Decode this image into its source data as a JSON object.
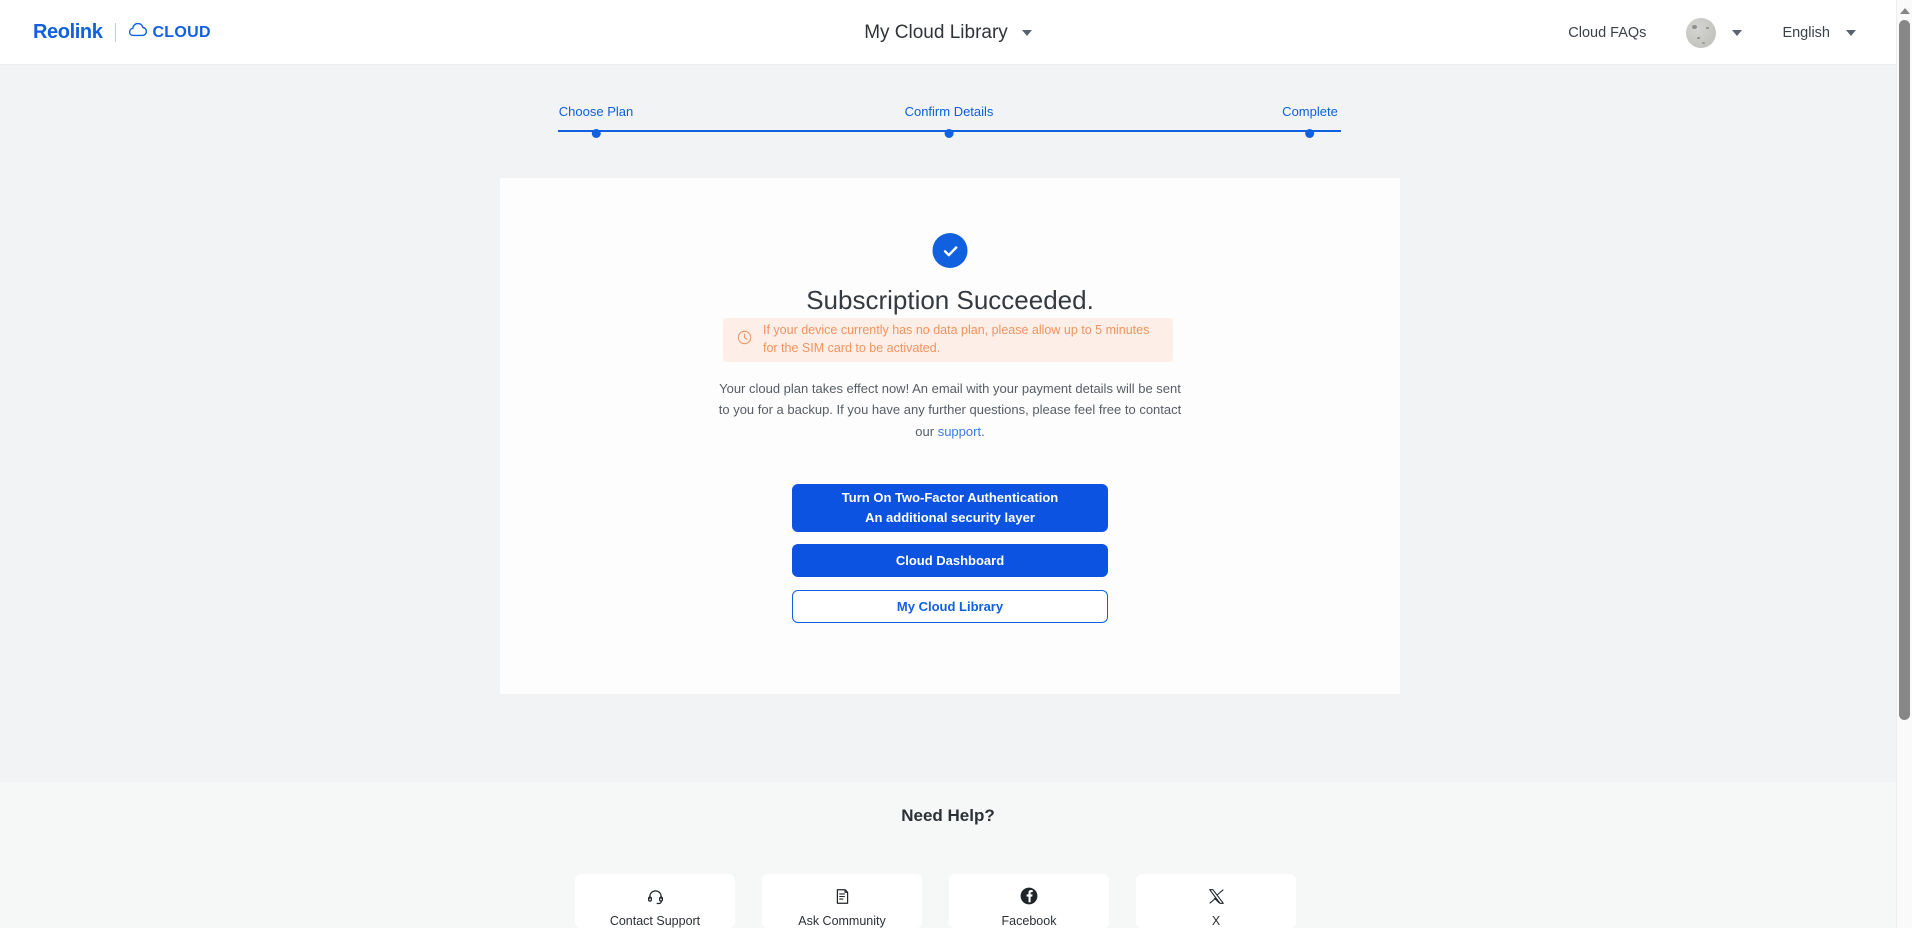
{
  "header": {
    "brand_name": "Reolink",
    "brand_product": "CLOUD",
    "cloud_icon": "cloud-icon",
    "page_title": "My Cloud Library",
    "page_title_caret": "chevron-down-icon",
    "cloud_faqs_label": "Cloud FAQs",
    "avatar_name": "user-avatar",
    "account_caret": "chevron-down-icon",
    "language_label": "English",
    "language_caret": "chevron-down-icon"
  },
  "stepper": {
    "steps": [
      {
        "label": "Choose Plan",
        "state": "complete"
      },
      {
        "label": "Confirm Details",
        "state": "complete"
      },
      {
        "label": "Complete",
        "state": "active"
      }
    ],
    "line_color": "#1060e0",
    "dot_color": "#1060e0"
  },
  "card": {
    "status_icon": "check-circle-icon",
    "status_icon_color": "#1060e0",
    "title": "Subscription Succeeded.",
    "warning": {
      "icon": "clock-icon",
      "text": "If your device currently has no data plan, please allow up to 5 minutes for the SIM card to be activated.",
      "background_color": "#fdeee7",
      "text_color": "#f09460"
    },
    "body_text_before_link": "Your cloud plan takes effect now! An email with your payment details will be sent to you for a backup. If you have any further questions, please feel free to contact our ",
    "body_link_text": "support",
    "body_text_after_link": ".",
    "buttons": [
      {
        "line1": "Turn On Two-Factor Authentication",
        "line2": "An additional security layer",
        "style": "primary"
      },
      {
        "line1": "Cloud Dashboard",
        "style": "primary"
      },
      {
        "line1": "My Cloud Library",
        "style": "outline"
      }
    ],
    "primary_color": "#0b53e0"
  },
  "footer": {
    "heading": "Need Help?",
    "help_cards": [
      {
        "icon": "headset-icon",
        "label": "Contact Support"
      },
      {
        "icon": "document-icon",
        "label": "Ask Community"
      },
      {
        "icon": "facebook-icon",
        "label": "Facebook"
      },
      {
        "icon": "x-twitter-icon",
        "label": "X"
      }
    ]
  },
  "scrollbar": {
    "up_arrow": "scroll-up-arrow-icon",
    "thumb": "scrollbar-thumb"
  }
}
